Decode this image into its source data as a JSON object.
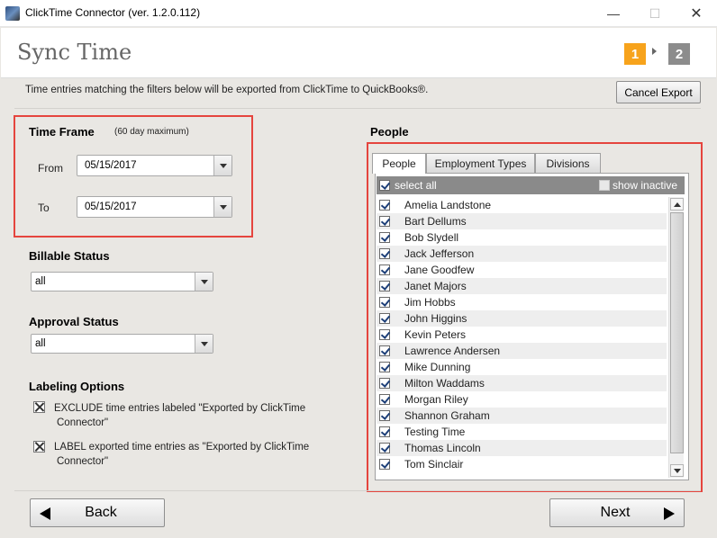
{
  "window": {
    "title": "ClickTime Connector (ver. 1.2.0.112)",
    "controls": {
      "minimize": "—",
      "maximize": "☐",
      "close": "✕"
    }
  },
  "header": {
    "title": "Sync Time",
    "steps": [
      "1",
      "2"
    ],
    "active_step": "1",
    "colors": {
      "active_step": "#f7a31c",
      "inactive_step": "#8c8c8c"
    }
  },
  "description": "Time entries matching the filters below will be exported from ClickTime to QuickBooks®.",
  "cancel_export_label": "Cancel Export",
  "time_frame": {
    "heading": "Time Frame",
    "note": "(60 day maximum)",
    "from_label": "From",
    "from_value": "05/15/2017",
    "to_label": "To",
    "to_value": "05/15/2017"
  },
  "billable_status": {
    "heading": "Billable Status",
    "value": "all"
  },
  "approval_status": {
    "heading": "Approval Status",
    "value": "all"
  },
  "labeling_options": {
    "heading": "Labeling Options",
    "exclude_line1": "EXCLUDE time entries labeled \"Exported by ClickTime",
    "exclude_line2": "Connector\"",
    "label_line1": "LABEL exported time entries as \"Exported by ClickTime",
    "label_line2": "Connector\""
  },
  "people": {
    "heading": "People",
    "tabs": [
      "People",
      "Employment Types",
      "Divisions"
    ],
    "active_tab": "People",
    "select_all_label": "select all",
    "show_inactive_label": "show inactive",
    "names": [
      "Amelia Landstone",
      "Bart Dellums",
      "Bob Slydell",
      "Jack Jefferson",
      "Jane Goodfew",
      "Janet Majors",
      "Jim Hobbs",
      "John Higgins",
      "Kevin Peters",
      "Lawrence Andersen",
      "Mike Dunning",
      "Milton Waddams",
      "Morgan Riley",
      "Shannon Graham",
      "Testing Time",
      "Thomas Lincoln",
      "Tom Sinclair"
    ]
  },
  "footer": {
    "back_label": "Back",
    "next_label": "Next"
  },
  "colors": {
    "highlight_border": "#e5453e"
  }
}
